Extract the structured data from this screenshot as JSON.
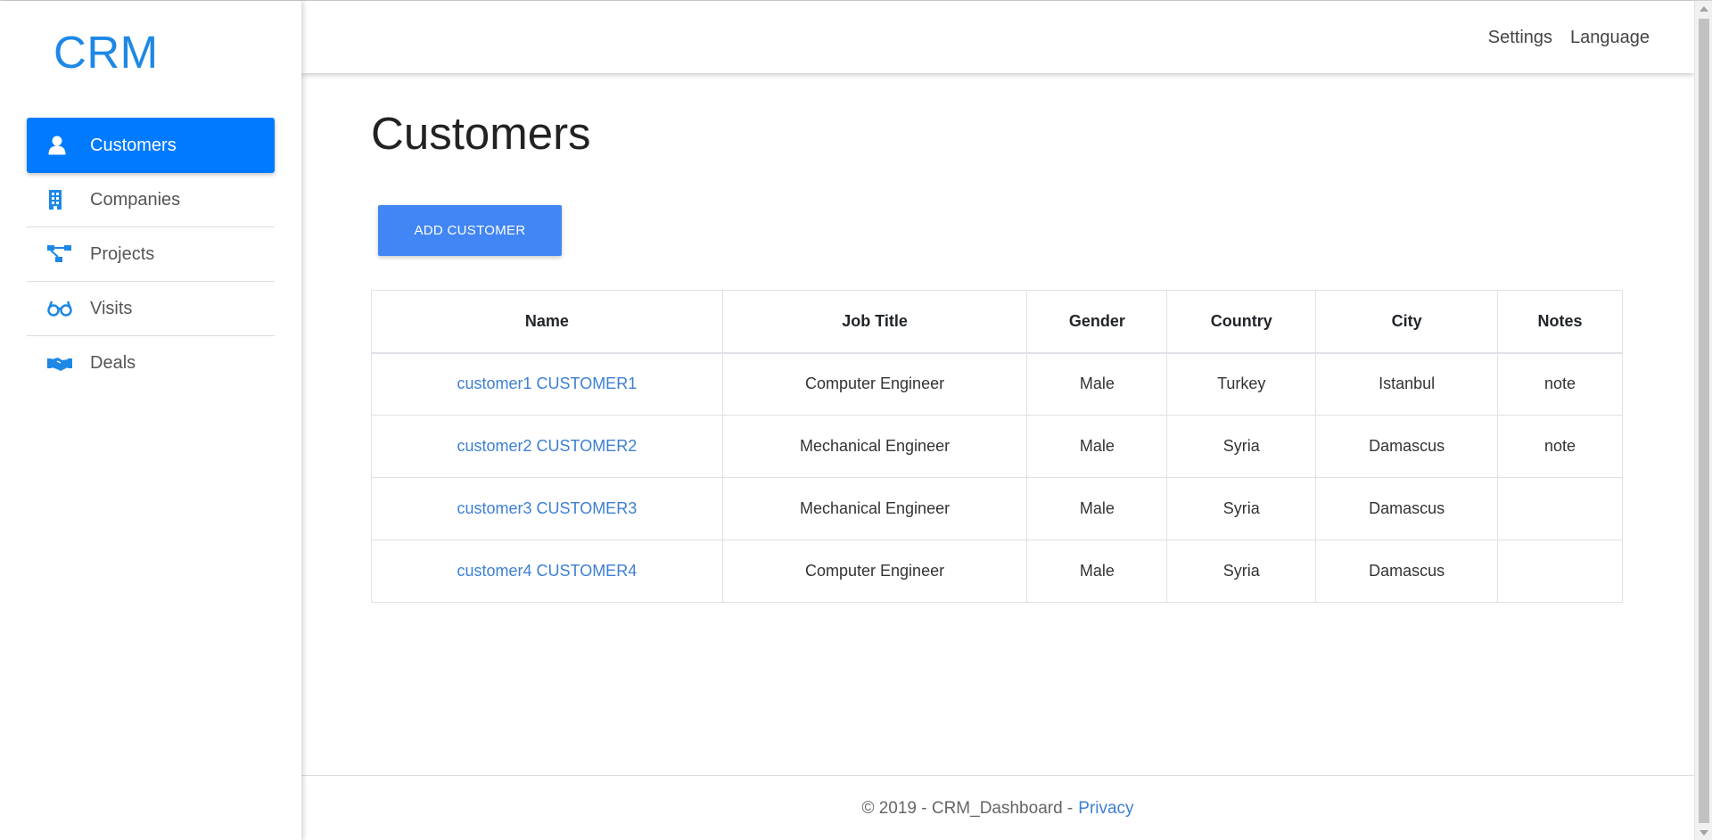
{
  "app": {
    "logo": "CRM"
  },
  "colors": {
    "accent": "#007bff",
    "button": "#4285f4",
    "link": "#3d7fd3"
  },
  "sidebar": {
    "items": [
      {
        "label": "Customers",
        "icon": "user-icon",
        "active": true
      },
      {
        "label": "Companies",
        "icon": "building-icon",
        "active": false
      },
      {
        "label": "Projects",
        "icon": "project-diagram-icon",
        "active": false
      },
      {
        "label": "Visits",
        "icon": "glasses-icon",
        "active": false
      },
      {
        "label": "Deals",
        "icon": "handshake-icon",
        "active": false
      }
    ]
  },
  "topbar": {
    "settings": "Settings",
    "language": "Language"
  },
  "main": {
    "title": "Customers",
    "add_button": "ADD CUSTOMER",
    "table": {
      "headers": [
        "Name",
        "Job Title",
        "Gender",
        "Country",
        "City",
        "Notes"
      ],
      "rows": [
        {
          "name": "customer1 CUSTOMER1",
          "job_title": "Computer Engineer",
          "gender": "Male",
          "country": "Turkey",
          "city": "Istanbul",
          "notes": "note"
        },
        {
          "name": "customer2 CUSTOMER2",
          "job_title": "Mechanical Engineer",
          "gender": "Male",
          "country": "Syria",
          "city": "Damascus",
          "notes": "note"
        },
        {
          "name": "customer3 CUSTOMER3",
          "job_title": "Mechanical Engineer",
          "gender": "Male",
          "country": "Syria",
          "city": "Damascus",
          "notes": ""
        },
        {
          "name": "customer4 CUSTOMER4",
          "job_title": "Computer Engineer",
          "gender": "Male",
          "country": "Syria",
          "city": "Damascus",
          "notes": ""
        }
      ]
    }
  },
  "footer": {
    "text": "© 2019 - CRM_Dashboard -",
    "privacy": "Privacy"
  }
}
